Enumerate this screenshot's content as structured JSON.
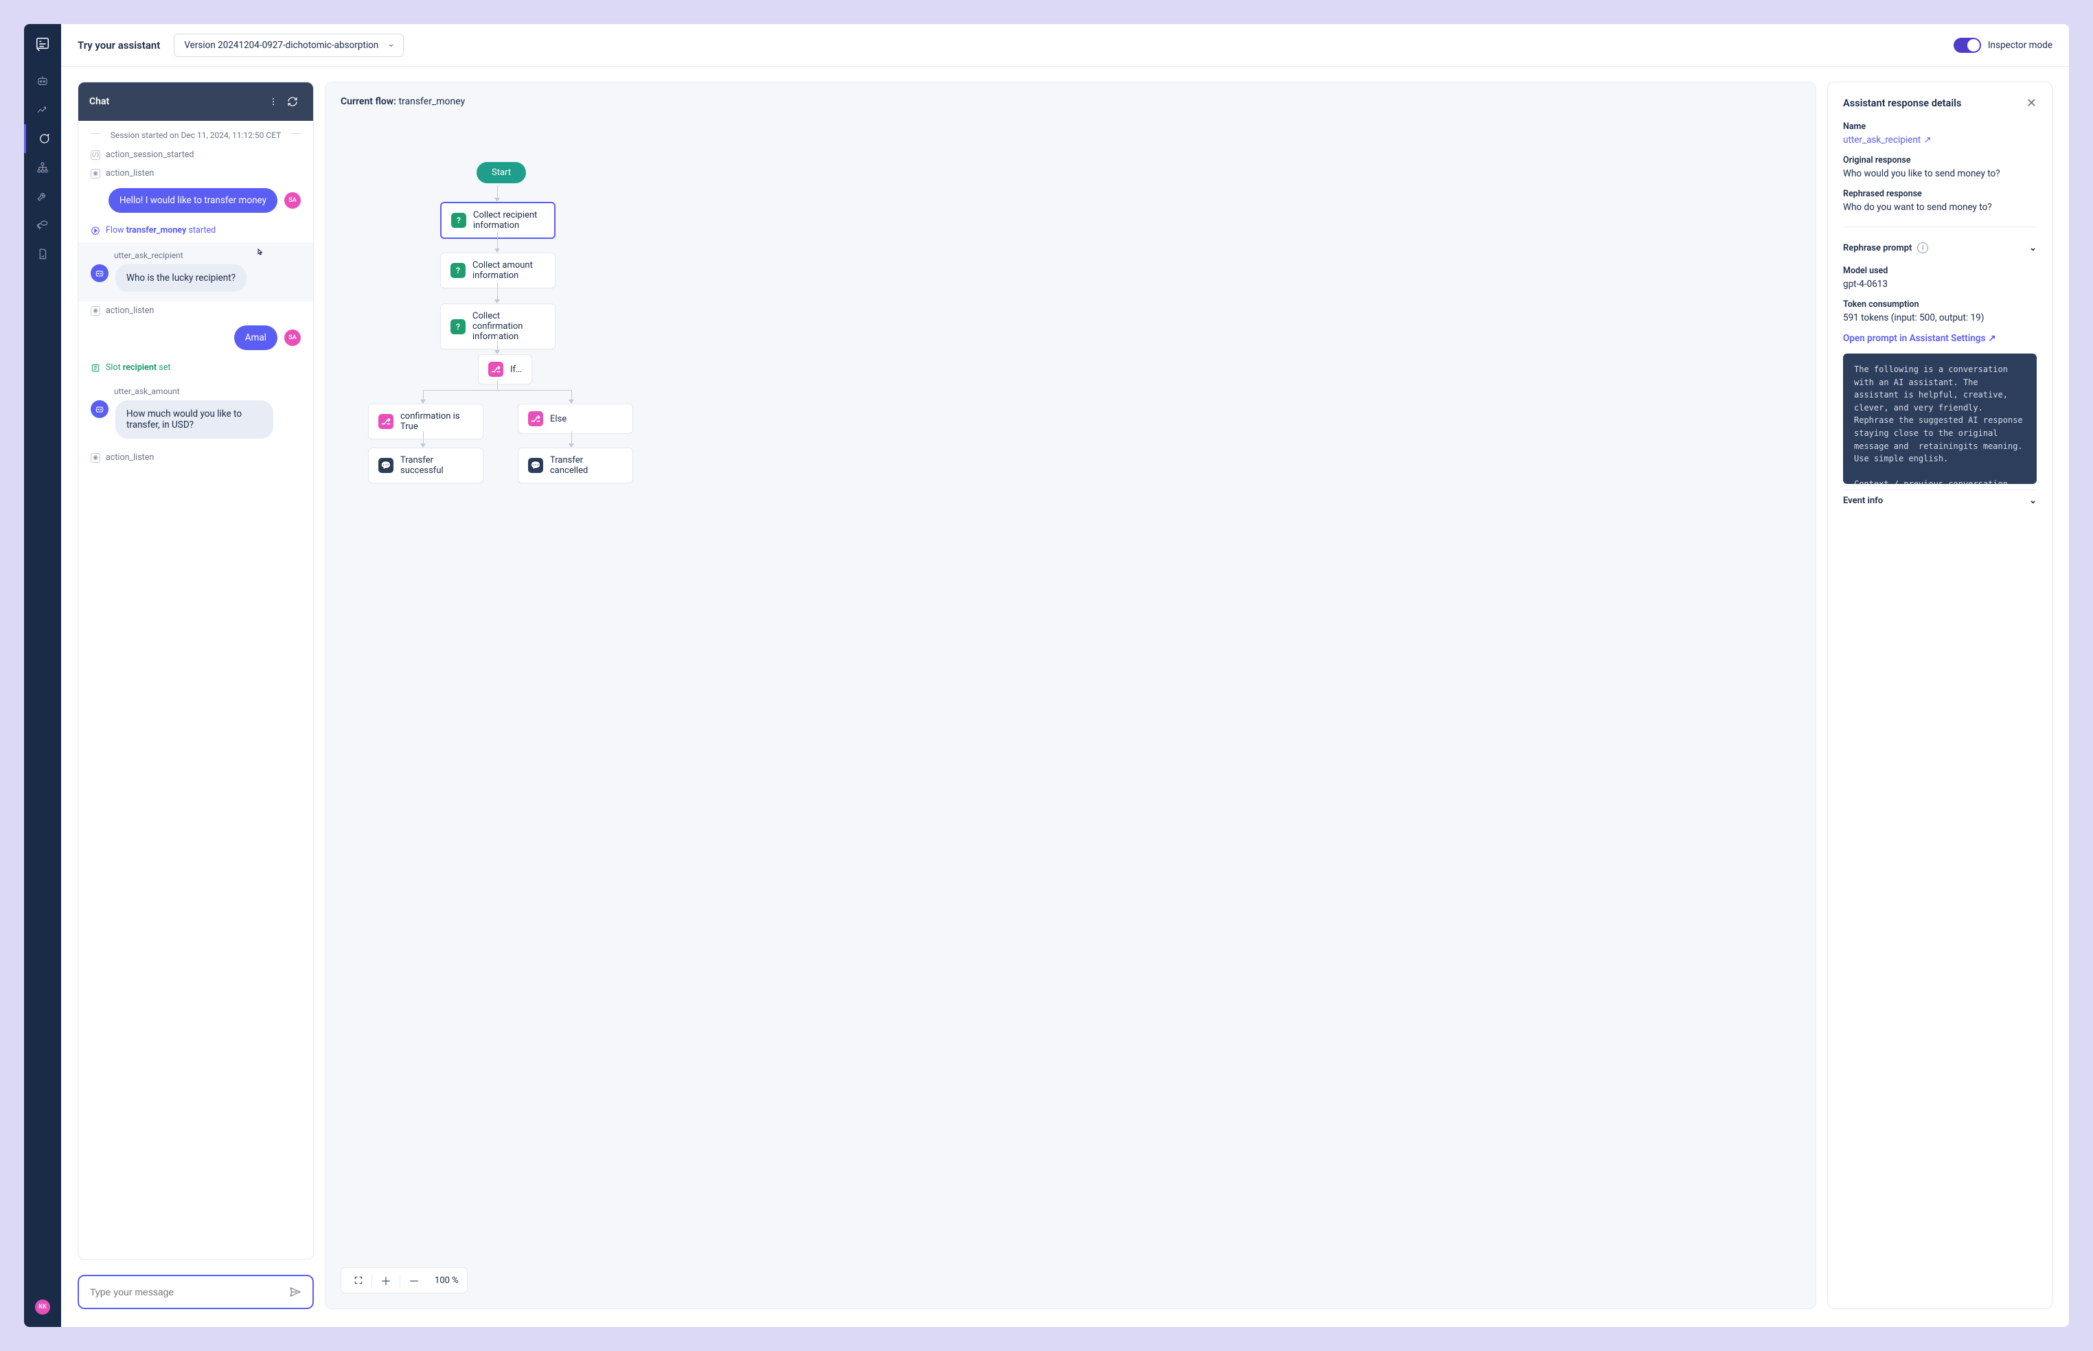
{
  "topbar": {
    "title": "Try your assistant",
    "version": "Version 20241204-0927-dichotomic-absorption",
    "inspector_label": "Inspector mode"
  },
  "sidebar": {
    "avatar": "KK"
  },
  "chat": {
    "title": "Chat",
    "session": "Session started on Dec 11, 2024, 11:12:50 CET",
    "evt1": "action_session_started",
    "evt2": "action_listen",
    "user1": "Hello! I would like to transfer money",
    "user_initials": "SA",
    "flow_prefix": "Flow ",
    "flow_name": "transfer_money",
    "flow_suffix": " started",
    "ask_recipient_label": "utter_ask_recipient",
    "ask_recipient_msg": "Who is the lucky recipient?",
    "evt3": "action_listen",
    "user2": "Amal",
    "slot_prefix": "Slot ",
    "slot_name": "recipient",
    "slot_suffix": " set",
    "ask_amount_label": "utter_ask_amount",
    "ask_amount_msg": "How much would you like to transfer, in USD?",
    "evt4": "action_listen",
    "input_placeholder": "Type your message"
  },
  "flow": {
    "title_prefix": "Current flow: ",
    "title_name": "transfer_money",
    "start": "Start",
    "n1": "Collect recipient information",
    "n2": "Collect amount information",
    "n3": "Collect confirmation information",
    "n4": "If…",
    "n5": "confirmation is True",
    "n6": "Else",
    "n7": "Transfer successful",
    "n8": "Transfer cancelled",
    "zoom": "100 %"
  },
  "details": {
    "title": "Assistant response details",
    "name_label": "Name",
    "name_value": "utter_ask_recipient",
    "orig_label": "Original response",
    "orig_value": "Who would you like to send money to?",
    "reph_label": "Rephrased response",
    "reph_value": "Who do you want to send money to?",
    "rephrase_prompt": "Rephrase prompt",
    "model_label": "Model used",
    "model_value": "gpt-4-0613",
    "tokens_label": "Token consumption",
    "tokens_value": "591 tokens (input: 500, output: 19)",
    "open_prompt": "Open prompt in Assistant Settings",
    "prompt_text": "The following is a conversation with an AI assistant. The assistant is helpful, creative, clever, and very friendly. Rephrase the suggested AI response staying close to the original message and  retainingits meaning. Use simple english.\n\nContext / previous conversation with the user: the user asks for a job openings",
    "event_info": "Event info"
  }
}
